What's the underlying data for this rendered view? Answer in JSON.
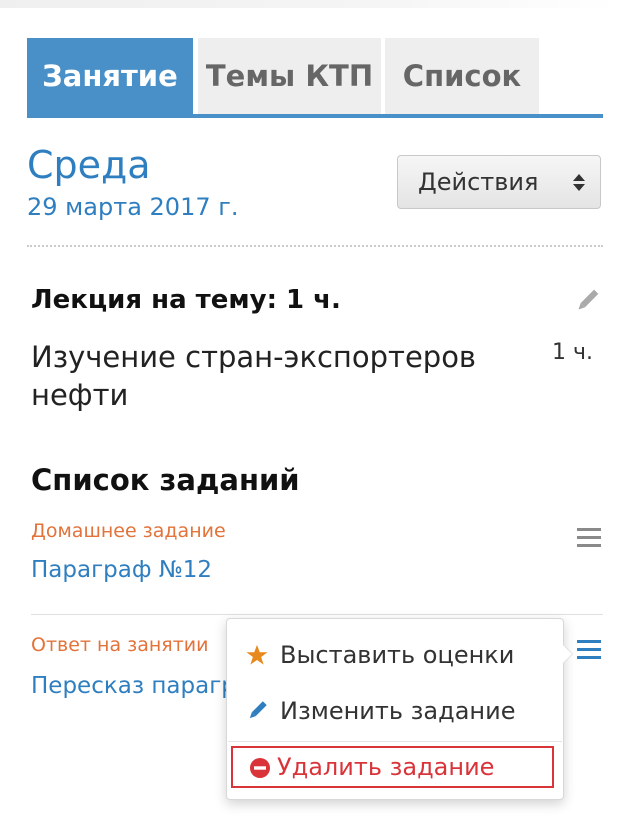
{
  "tabs": [
    {
      "label": "Занятие",
      "active": true
    },
    {
      "label": "Темы КТП",
      "active": false
    },
    {
      "label": "Список",
      "active": false
    }
  ],
  "header": {
    "day": "Среда",
    "date": "29 марта 2017 г.",
    "actions_label": "Действия"
  },
  "lecture": {
    "title": "Лекция на тему: 1 ч.",
    "topic": "Изучение стран-экспортеров нефти",
    "hours": "1 ч."
  },
  "tasks": {
    "title": "Список заданий",
    "items": [
      {
        "type": "Домашнее задание",
        "name": "Параграф №12"
      },
      {
        "type": "Ответ на занятии",
        "name": "Пересказ параграфа"
      }
    ]
  },
  "dropdown": {
    "items": [
      {
        "label": "Выставить оценки",
        "icon": "star-icon"
      },
      {
        "label": "Изменить задание",
        "icon": "pencil-icon"
      },
      {
        "label": "Удалить задание",
        "icon": "minus-circle-icon"
      }
    ]
  },
  "colors": {
    "accent": "#4a90c8",
    "link": "#2f7fc0",
    "task_type": "#e2733a",
    "danger": "#d9343a",
    "star": "#e8891d"
  }
}
